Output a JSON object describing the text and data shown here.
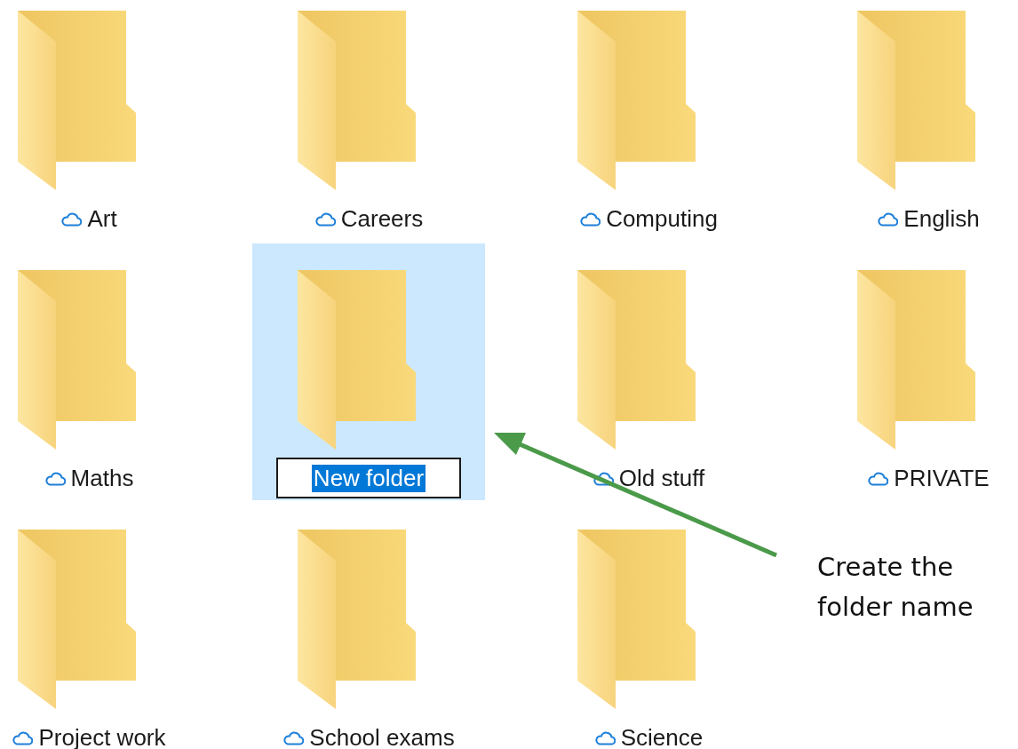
{
  "folders": [
    {
      "name": "Art",
      "kind": "synced",
      "selected": false
    },
    {
      "name": "Careers",
      "kind": "synced",
      "selected": false
    },
    {
      "name": "Computing",
      "kind": "synced",
      "selected": false
    },
    {
      "name": "English",
      "kind": "synced",
      "selected": false
    },
    {
      "name": "Maths",
      "kind": "synced",
      "selected": false
    },
    {
      "name": "New folder",
      "kind": "renaming",
      "selected": true
    },
    {
      "name": "Old stuff",
      "kind": "synced",
      "selected": false
    },
    {
      "name": "PRIVATE",
      "kind": "synced",
      "selected": false
    },
    {
      "name": "Project work",
      "kind": "synced",
      "selected": false
    },
    {
      "name": "School exams",
      "kind": "synced",
      "selected": false
    },
    {
      "name": "Science",
      "kind": "synced",
      "selected": false
    }
  ],
  "annotation": {
    "text": "Create the folder name"
  }
}
